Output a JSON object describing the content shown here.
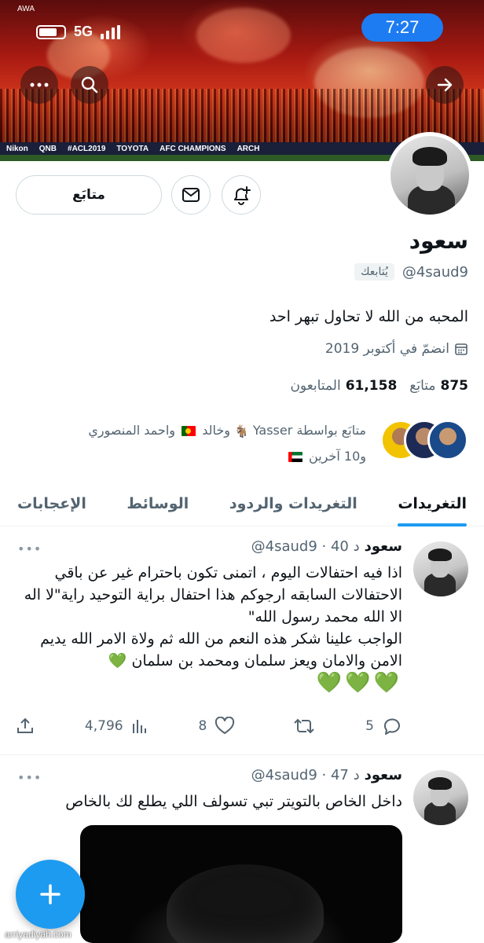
{
  "status_bar": {
    "carrier": "AWA",
    "network": "5G",
    "time": "7:27"
  },
  "banner": {
    "boards": [
      "Nikon",
      "QNB",
      "#ACL2019",
      "TOYOTA",
      "AFC CHAMPIONS",
      "ARCH"
    ]
  },
  "profile": {
    "follow_label": "متابَع",
    "name": "سعود",
    "handle": "@4saud9",
    "follows_you": "يُتابعك",
    "bio": "المحبه من الله لا تحاول تبهر احد",
    "joined": "انضمّ في أكتوبر 2019",
    "following_count": "875",
    "following_label": "متابَع",
    "followers_count": "61,158",
    "followers_label": "المتابعون",
    "known_followers_line1_prefix": "متابَع بواسطة",
    "known_followers_name1": "Yasser",
    "known_followers_name2": "وخالد",
    "known_followers_name3": "واحمد المنصوري",
    "known_followers_line2": "و10 آخرين"
  },
  "tabs": [
    "التغريدات",
    "التغريدات والردود",
    "الوسائط",
    "الإعجابات"
  ],
  "tweets": [
    {
      "name": "سعود",
      "meta": "@4saud9 · 40 د",
      "body_lines": [
        "اذا فيه احتفالات اليوم ، اتمنى تكون باحترام غير عن باقي الاحتفالات السابقه ارجوكم هذا احتفال براية التوحيد راية\"لا اله الا الله محمد رسول الله\"",
        "الواجب علينا شكر هذه النعم من الله ثم ولاة الامر الله يديم الامن والامان ويعز سلمان ومحمد بن سلمان 💚"
      ],
      "hearts": "💚💚💚",
      "replies": "5",
      "retweets": "",
      "likes": "8",
      "views": "4,796"
    },
    {
      "name": "سعود",
      "meta": "@4saud9 · 47 د",
      "body": "داخل الخاص بالتويتر تبي تسولف اللي يطلع لك بالخاص"
    }
  ],
  "watermark": "arriyadiyah.com",
  "colors": {
    "accent": "#1d9bf0",
    "time_pill": "#1d7cf2",
    "secondary_text": "#536471"
  },
  "icons": [
    "more-icon",
    "search-icon",
    "forward-arrow-icon",
    "mail-icon",
    "add-notification-icon",
    "calendar-icon",
    "reply-icon",
    "retweet-icon",
    "like-icon",
    "views-icon",
    "share-icon",
    "compose-icon"
  ]
}
